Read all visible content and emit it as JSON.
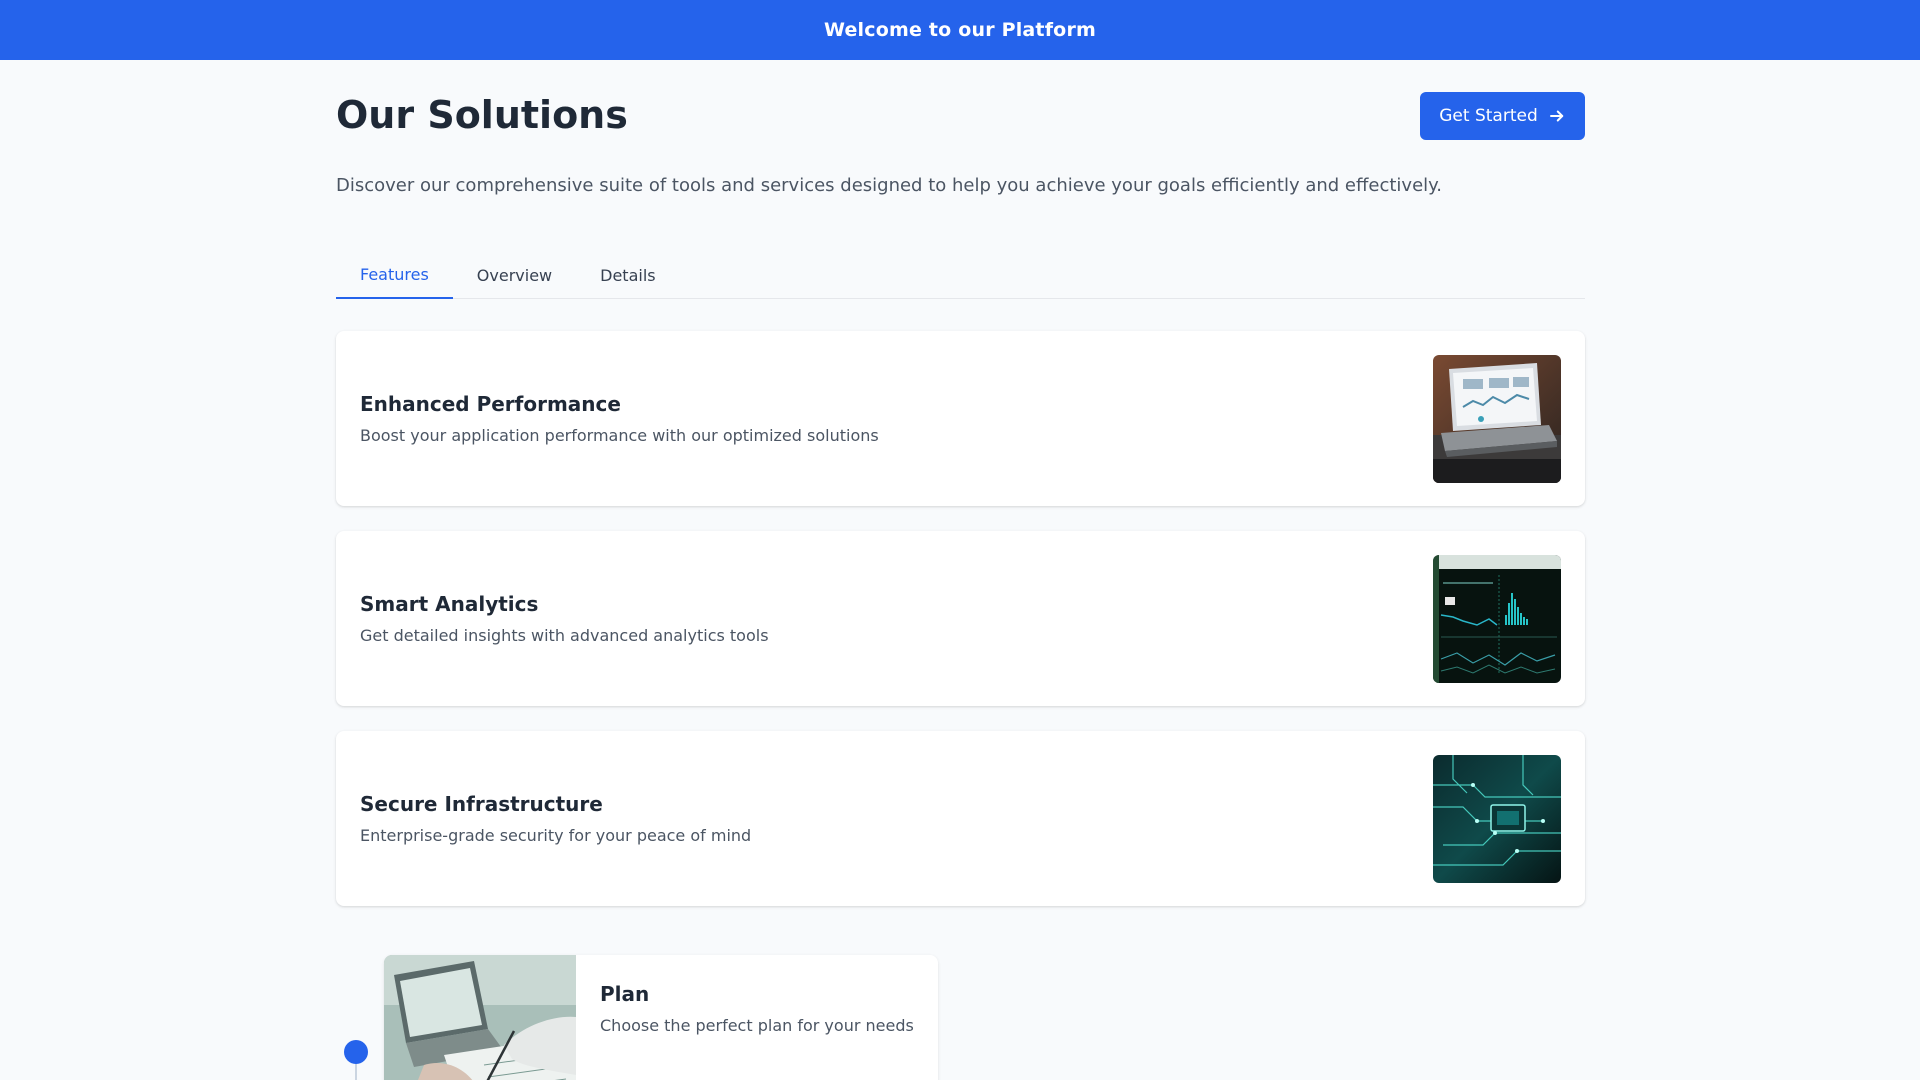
{
  "banner": {
    "text": "Welcome to our Platform"
  },
  "header": {
    "title": "Our Solutions",
    "cta_label": "Get Started",
    "cta_icon": "arrow-right-icon"
  },
  "intro": {
    "text": "Discover our comprehensive suite of tools and services designed to help you achieve your goals efficiently and effectively."
  },
  "tabs": [
    {
      "label": "Features",
      "active": true
    },
    {
      "label": "Overview",
      "active": false
    },
    {
      "label": "Details",
      "active": false
    }
  ],
  "features": [
    {
      "title": "Enhanced Performance",
      "description": "Boost your application performance with our optimized solutions",
      "image": "laptop-dashboard-photo"
    },
    {
      "title": "Smart Analytics",
      "description": "Get detailed insights with advanced analytics tools",
      "image": "analytics-screen-photo"
    },
    {
      "title": "Secure Infrastructure",
      "description": "Enterprise-grade security for your peace of mind",
      "image": "circuit-board-photo"
    }
  ],
  "timeline": [
    {
      "title": "Plan",
      "description": "Choose the perfect plan for your needs",
      "image": "planning-desk-photo"
    }
  ],
  "colors": {
    "primary": "#2563eb",
    "background": "#f8fafc",
    "text": "#1f2937",
    "muted": "#4b5563"
  }
}
